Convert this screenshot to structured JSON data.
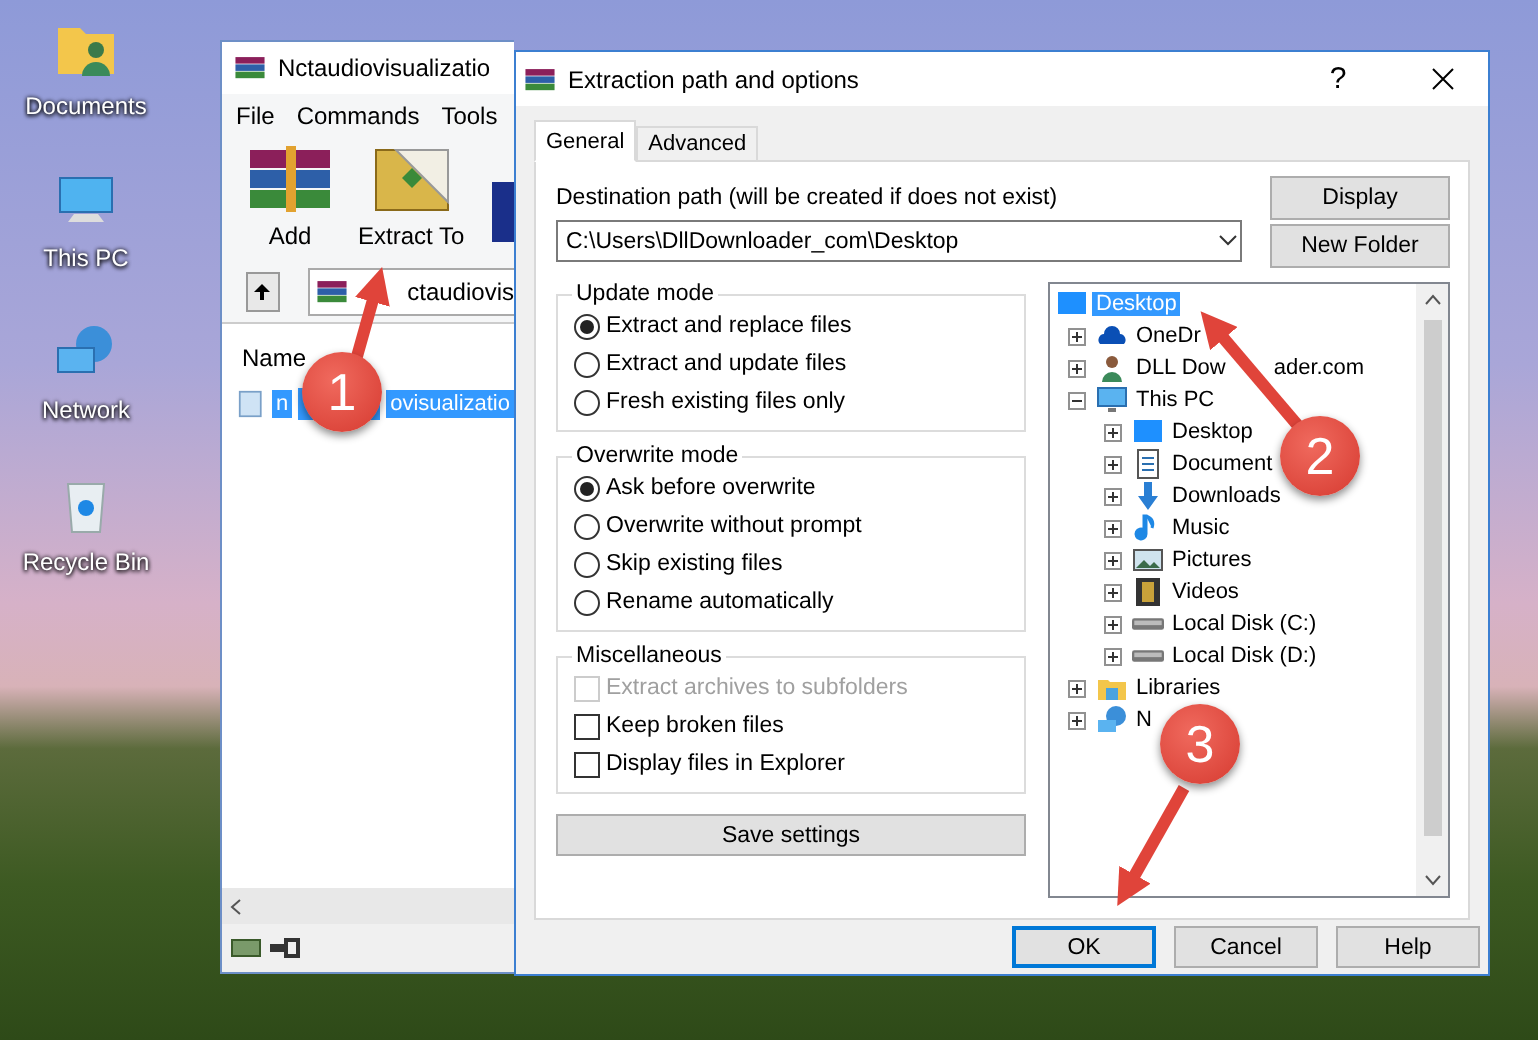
{
  "desktop_icons": [
    {
      "label": "Documents",
      "kind": "folder"
    },
    {
      "label": "This PC",
      "kind": "pc"
    },
    {
      "label": "Network",
      "kind": "network"
    },
    {
      "label": "Recycle Bin",
      "kind": "bin"
    }
  ],
  "archive_window": {
    "title": "Nctaudiovisualizatio",
    "menu": [
      "File",
      "Commands",
      "Tools"
    ],
    "toolbar": [
      {
        "label": "Add",
        "kind": "add"
      },
      {
        "label": "Extract To",
        "kind": "extract"
      },
      {
        "kind": "book"
      }
    ],
    "address": "ctaudiovis",
    "column": "Name",
    "file": {
      "name_start": "n",
      "name_end": "ovisualizatio",
      "selected": true
    }
  },
  "dialog": {
    "title": "Extraction path and options",
    "help": "?",
    "tabs": [
      {
        "label": "General",
        "selected": true
      },
      {
        "label": "Advanced",
        "selected": false
      }
    ],
    "destination_label": "Destination path (will be created if does not exist)",
    "destination_value": "C:\\Users\\DllDownloader_com\\Desktop",
    "side_buttons": [
      "Display",
      "New Folder"
    ],
    "groups": [
      {
        "title": "Update mode",
        "kind": "radio",
        "options": [
          {
            "label": "Extract and replace files",
            "selected": true
          },
          {
            "label": "Extract and update files",
            "selected": false
          },
          {
            "label": "Fresh existing files only",
            "selected": false
          }
        ]
      },
      {
        "title": "Overwrite mode",
        "kind": "radio",
        "options": [
          {
            "label": "Ask before overwrite",
            "selected": true
          },
          {
            "label": "Overwrite without prompt",
            "selected": false
          },
          {
            "label": "Skip existing files",
            "selected": false
          },
          {
            "label": "Rename automatically",
            "selected": false
          }
        ]
      },
      {
        "title": "Miscellaneous",
        "kind": "checkbox",
        "options": [
          {
            "label": "Extract archives to subfolders",
            "checked": false,
            "disabled": true
          },
          {
            "label": "Keep broken files",
            "checked": false,
            "disabled": false
          },
          {
            "label": "Display files in Explorer",
            "checked": false,
            "disabled": false
          }
        ]
      }
    ],
    "save_button": "Save settings",
    "tree": {
      "label": "Desktop",
      "kind": "desktop",
      "selected": true,
      "children": [
        {
          "label": "OneDr",
          "kind": "cloud",
          "selected": false,
          "expanded": false
        },
        {
          "label": "DLL Dow",
          "label_rest": "ader.com",
          "kind": "user",
          "selected": false,
          "expanded": false
        },
        {
          "label": "This PC",
          "kind": "pc",
          "selected": false,
          "expanded": true,
          "children": [
            {
              "label": "Desktop",
              "kind": "desktop",
              "selected": false,
              "expanded": false
            },
            {
              "label": "Document",
              "kind": "docs",
              "selected": false,
              "expanded": false
            },
            {
              "label": "Downloads",
              "kind": "download",
              "selected": false,
              "expanded": false
            },
            {
              "label": "Music",
              "kind": "music",
              "selected": false,
              "expanded": false
            },
            {
              "label": "Pictures",
              "kind": "pictures",
              "selected": false,
              "expanded": false
            },
            {
              "label": "Videos",
              "kind": "videos",
              "selected": false,
              "expanded": false
            },
            {
              "label": "Local Disk (C:)",
              "kind": "disk",
              "selected": false,
              "expanded": false
            },
            {
              "label": "Local Disk (D:)",
              "kind": "disk",
              "selected": false,
              "expanded": false
            }
          ]
        },
        {
          "label": "Libraries",
          "kind": "library",
          "selected": false,
          "expanded": false
        },
        {
          "label": "N",
          "kind": "network",
          "selected": false,
          "expanded": false
        }
      ]
    },
    "buttons": [
      {
        "label": "OK",
        "default": true
      },
      {
        "label": "Cancel",
        "default": false
      },
      {
        "label": "Help",
        "default": false
      }
    ]
  },
  "steps": [
    {
      "number": "1"
    },
    {
      "number": "2"
    },
    {
      "number": "3"
    }
  ]
}
